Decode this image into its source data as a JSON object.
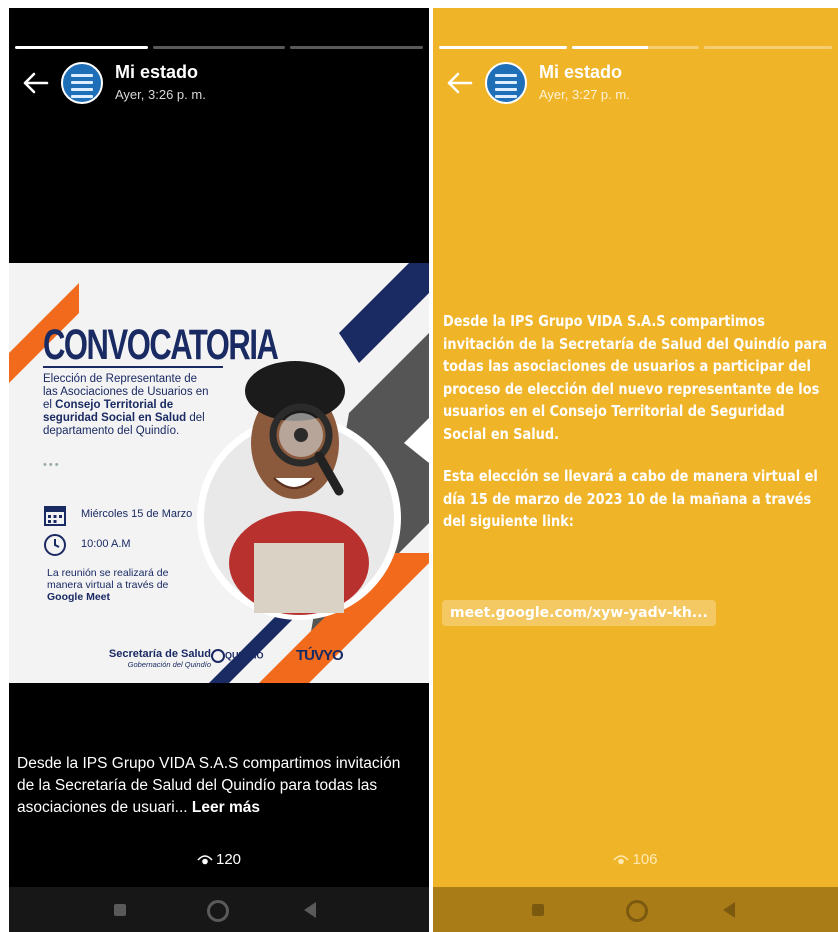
{
  "left": {
    "header": {
      "title": "Mi estado",
      "time": "Ayer, 3:26 p. m."
    },
    "progress": [
      1,
      0,
      0
    ],
    "poster": {
      "title": "CONVOCATORIA",
      "desc_1": "Elección de Representante de las Asociaciones de Usuarios en el ",
      "desc_bold_1": "Consejo Territorial de seguridad Social en Salud",
      "desc_2": " del departamento del Quindío.",
      "dots": "•••",
      "date": "Miércoles 15 de Marzo",
      "time": "10:00 A.M",
      "note_1": "La reunión se realizará de manera virtual a través de ",
      "note_bold": "Google Meet",
      "sponsor_a": "Secretaría de Salud",
      "sponsor_b": "Gobernación del Quindío",
      "logo_quindio": "QUINDÍO",
      "logo_tuvoz": "TÚVYO"
    },
    "caption": {
      "text": "Desde la IPS Grupo VIDA S.A.S compartimos invitación de la Secretaría de Salud del Quindío para todas las asociaciones de usuari... ",
      "more": "Leer más"
    },
    "views": "120"
  },
  "right": {
    "header": {
      "title": "Mi estado",
      "time": "Ayer, 3:27 p. m."
    },
    "progress": [
      1,
      0.6,
      0
    ],
    "text_1": "Desde la IPS Grupo VIDA S.A.S compartimos invitación de la Secretaría de Salud del Quindío para todas las asociaciones de usuarios a participar del proceso de elección del nuevo representante de los usuarios en el Consejo Territorial de Seguridad Social en Salud.",
    "text_2": "Esta elección se llevará a cabo de manera virtual el día 15 de marzo de 2023 10 de la mañana a través del siguiente link:",
    "link": "meet.google.com/xyw-yadv-kh...",
    "views": "106"
  },
  "colors": {
    "left_bg": "#000000",
    "right_bg": "#f0b429",
    "poster_navy": "#1a2a63",
    "poster_orange": "#f26a1b"
  }
}
